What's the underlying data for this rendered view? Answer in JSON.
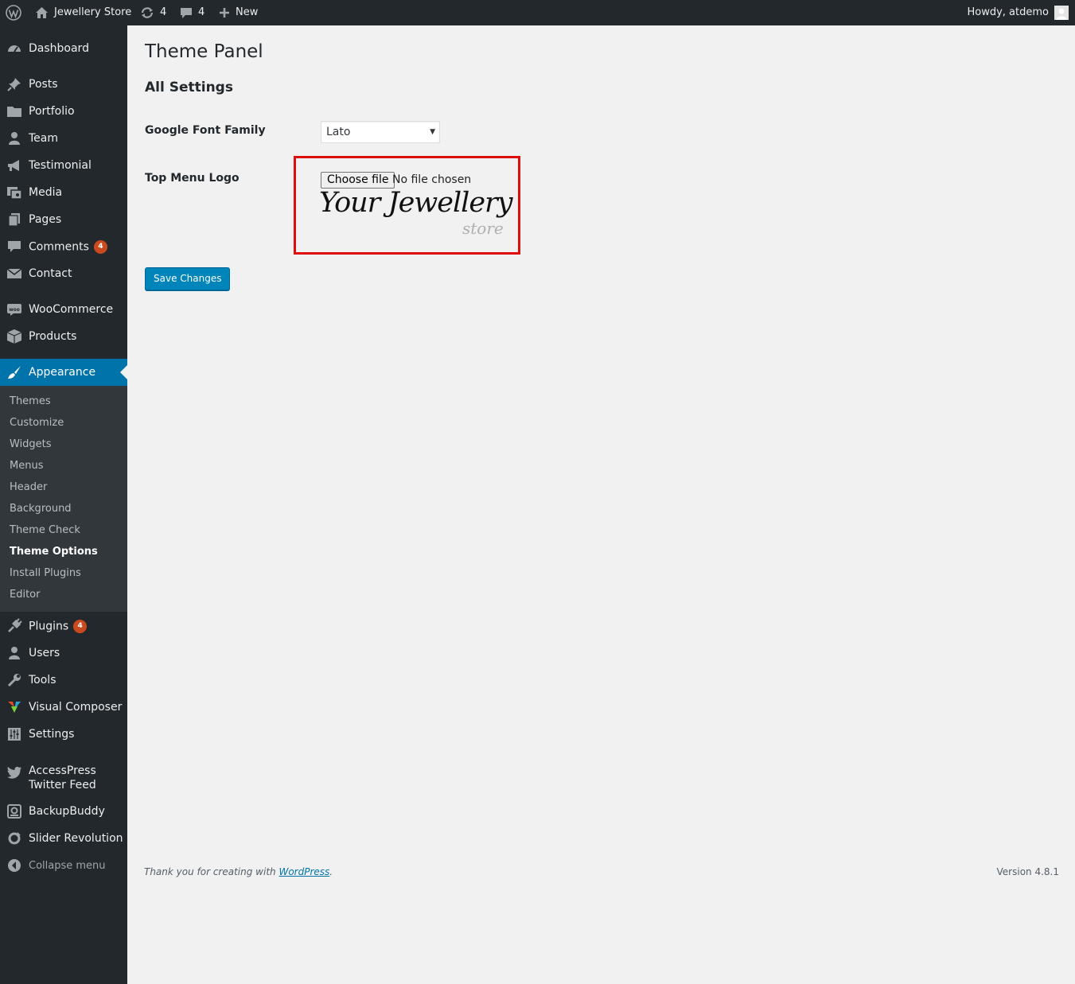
{
  "admin_bar": {
    "site_name": "Jewellery Store",
    "updates_count": "4",
    "comments_count": "4",
    "new_label": "New",
    "greeting": "Howdy, atdemo"
  },
  "sidebar": {
    "items": [
      {
        "label": "Dashboard"
      },
      {
        "label": "Posts"
      },
      {
        "label": "Portfolio"
      },
      {
        "label": "Team"
      },
      {
        "label": "Testimonial"
      },
      {
        "label": "Media"
      },
      {
        "label": "Pages"
      },
      {
        "label": "Comments",
        "badge": "4"
      },
      {
        "label": "Contact"
      },
      {
        "label": "WooCommerce"
      },
      {
        "label": "Products"
      },
      {
        "label": "Appearance"
      },
      {
        "label": "Plugins",
        "badge": "4"
      },
      {
        "label": "Users"
      },
      {
        "label": "Tools"
      },
      {
        "label": "Visual Composer"
      },
      {
        "label": "Settings"
      },
      {
        "label": "AccessPress Twitter Feed"
      },
      {
        "label": "BackupBuddy"
      },
      {
        "label": "Slider Revolution"
      }
    ],
    "submenu": [
      "Themes",
      "Customize",
      "Widgets",
      "Menus",
      "Header",
      "Background",
      "Theme Check",
      "Theme Options",
      "Install Plugins",
      "Editor"
    ],
    "collapse_label": "Collapse menu"
  },
  "main": {
    "page_title": "Theme Panel",
    "section_title": "All Settings",
    "font_label": "Google Font Family",
    "font_value": "Lato",
    "logo_label": "Top Menu Logo",
    "file_button": "Choose file",
    "file_status": "No file chosen",
    "logo_text": "Your Jewellery",
    "logo_subtext": "store",
    "save_button": "Save Changes"
  },
  "footer": {
    "thanks_prefix": "Thank you for creating with",
    "thanks_link": "WordPress",
    "thanks_suffix": ".",
    "version": "Version 4.8.1"
  },
  "colors": {
    "admin_dark": "#23282d",
    "submenu_bg": "#32373c",
    "accent": "#0073aa",
    "badge": "#ca4a1f",
    "highlight_border": "#e00d0d",
    "button_primary": "#0085ba"
  }
}
